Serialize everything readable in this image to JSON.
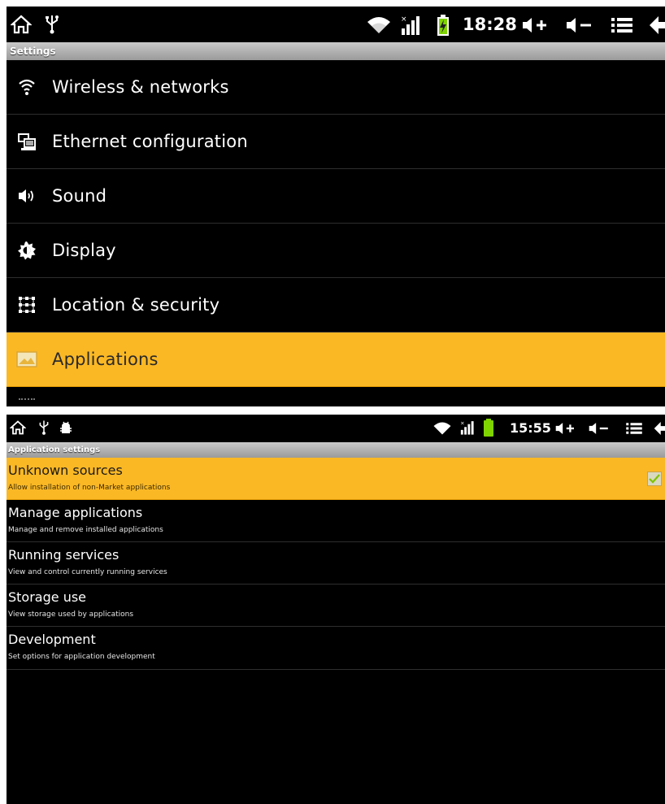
{
  "screen1": {
    "status": {
      "time": "18:28",
      "icons": [
        "home-icon",
        "usb-icon",
        "wifi-icon",
        "signal-icon",
        "battery-charging-icon",
        "volume-up-icon",
        "volume-down-icon",
        "menu-icon",
        "back-icon"
      ]
    },
    "title": "Settings",
    "items": [
      {
        "label": "Wireless & networks",
        "icon": "wifi-icon"
      },
      {
        "label": "Ethernet configuration",
        "icon": "ethernet-icon"
      },
      {
        "label": "Sound",
        "icon": "speaker-icon"
      },
      {
        "label": "Display",
        "icon": "brightness-icon"
      },
      {
        "label": "Location & security",
        "icon": "grid-lock-icon"
      },
      {
        "label": "Applications",
        "icon": "applications-icon",
        "selected": true
      }
    ]
  },
  "screen2": {
    "status": {
      "time": "15:55",
      "icons": [
        "home-icon",
        "usb-icon",
        "android-debug-icon",
        "wifi-icon",
        "signal-icon",
        "battery-icon",
        "volume-up-icon",
        "volume-down-icon",
        "menu-icon",
        "back-icon"
      ]
    },
    "title": "Application settings",
    "items": [
      {
        "title": "Unknown sources",
        "subtitle": "Allow installation of non-Market applications",
        "selected": true,
        "checked": true
      },
      {
        "title": "Manage applications",
        "subtitle": "Manage and remove installed applications"
      },
      {
        "title": "Running services",
        "subtitle": "View and control currently running services"
      },
      {
        "title": "Storage use",
        "subtitle": "View storage used by applications"
      },
      {
        "title": "Development",
        "subtitle": "Set options for application development"
      }
    ]
  },
  "colors": {
    "highlight": "#fbb825",
    "background": "#000000",
    "titlebar": "#a9a9a9",
    "battery_green": "#7fd400"
  }
}
